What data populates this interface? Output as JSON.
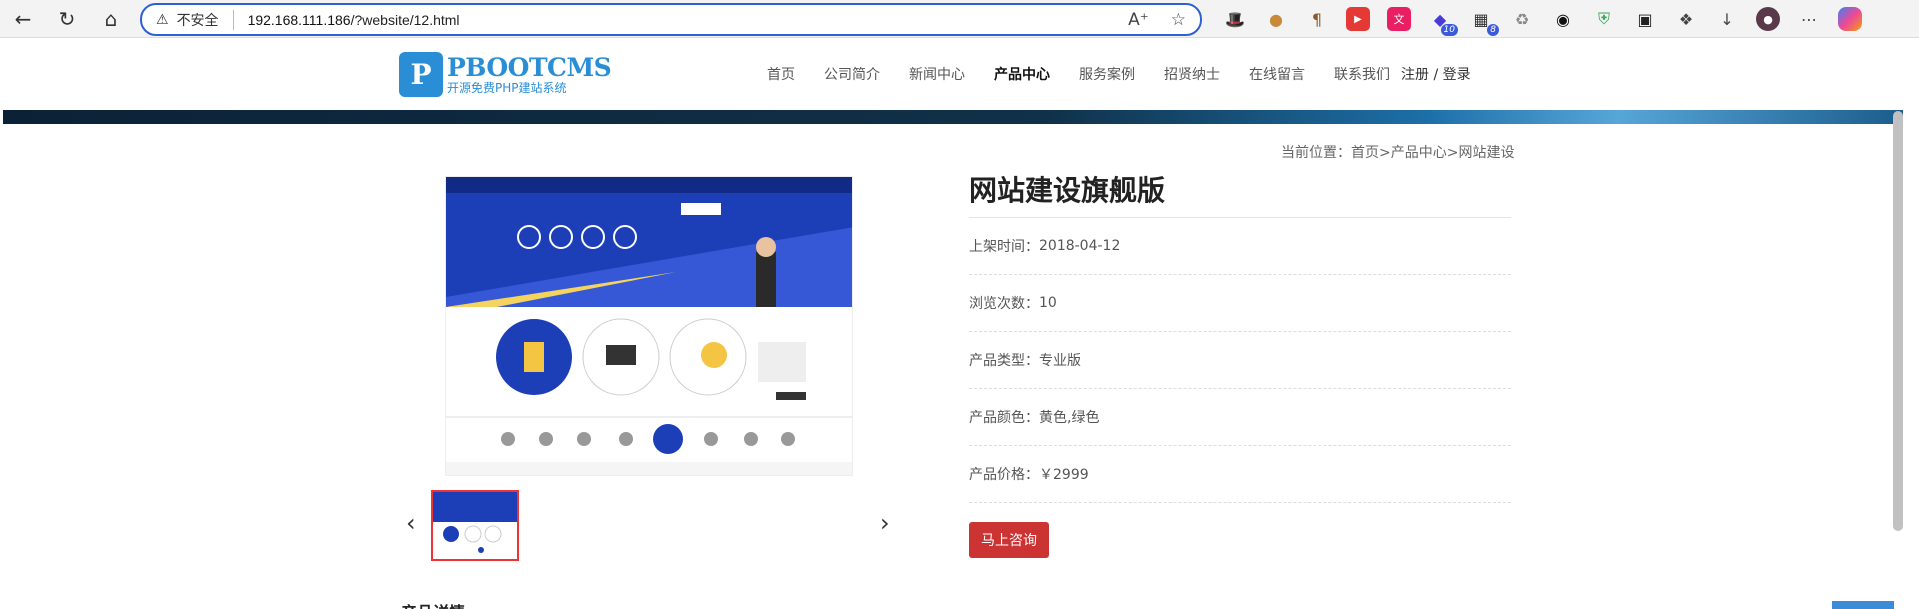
{
  "browser": {
    "security_label": "不安全",
    "url_host": "192.168.111.186",
    "url_path": "/?website/12.html",
    "icons": [
      "back-icon",
      "refresh-icon",
      "home-icon",
      "warning-icon",
      "read-aloud-icon",
      "favorite-star-icon"
    ],
    "extension_badges": [
      "10",
      "8"
    ]
  },
  "site": {
    "logo_name": "PBOOTCMS",
    "logo_sub": "开源免费PHP建站系统",
    "logo_mark": "P",
    "nav": [
      "首页",
      "公司简介",
      "新闻中心",
      "产品中心",
      "服务案例",
      "招贤纳士",
      "在线留言",
      "联系我们"
    ],
    "login": "注册 / 登录"
  },
  "breadcrumb": {
    "prefix": "当前位置：",
    "home": "首页",
    "sep1": ">",
    "category": "产品中心",
    "sep2": ">",
    "current": "网站建设"
  },
  "product": {
    "title": "网站建设旗舰版",
    "rows": [
      {
        "label": "上架时间：",
        "value": "2018-04-12"
      },
      {
        "label": "浏览次数：",
        "value": "10"
      },
      {
        "label": "产品类型：",
        "value": "专业版"
      },
      {
        "label": "产品颜色：",
        "value": "黄色,绿色"
      },
      {
        "label": "产品价格：",
        "value": "￥2999"
      }
    ],
    "consult_button": "马上咨询",
    "details_heading": "产品详情"
  },
  "colors": {
    "accent": "#2f5fd6",
    "brand": "#2a8ed6",
    "consult": "#cc3333"
  }
}
